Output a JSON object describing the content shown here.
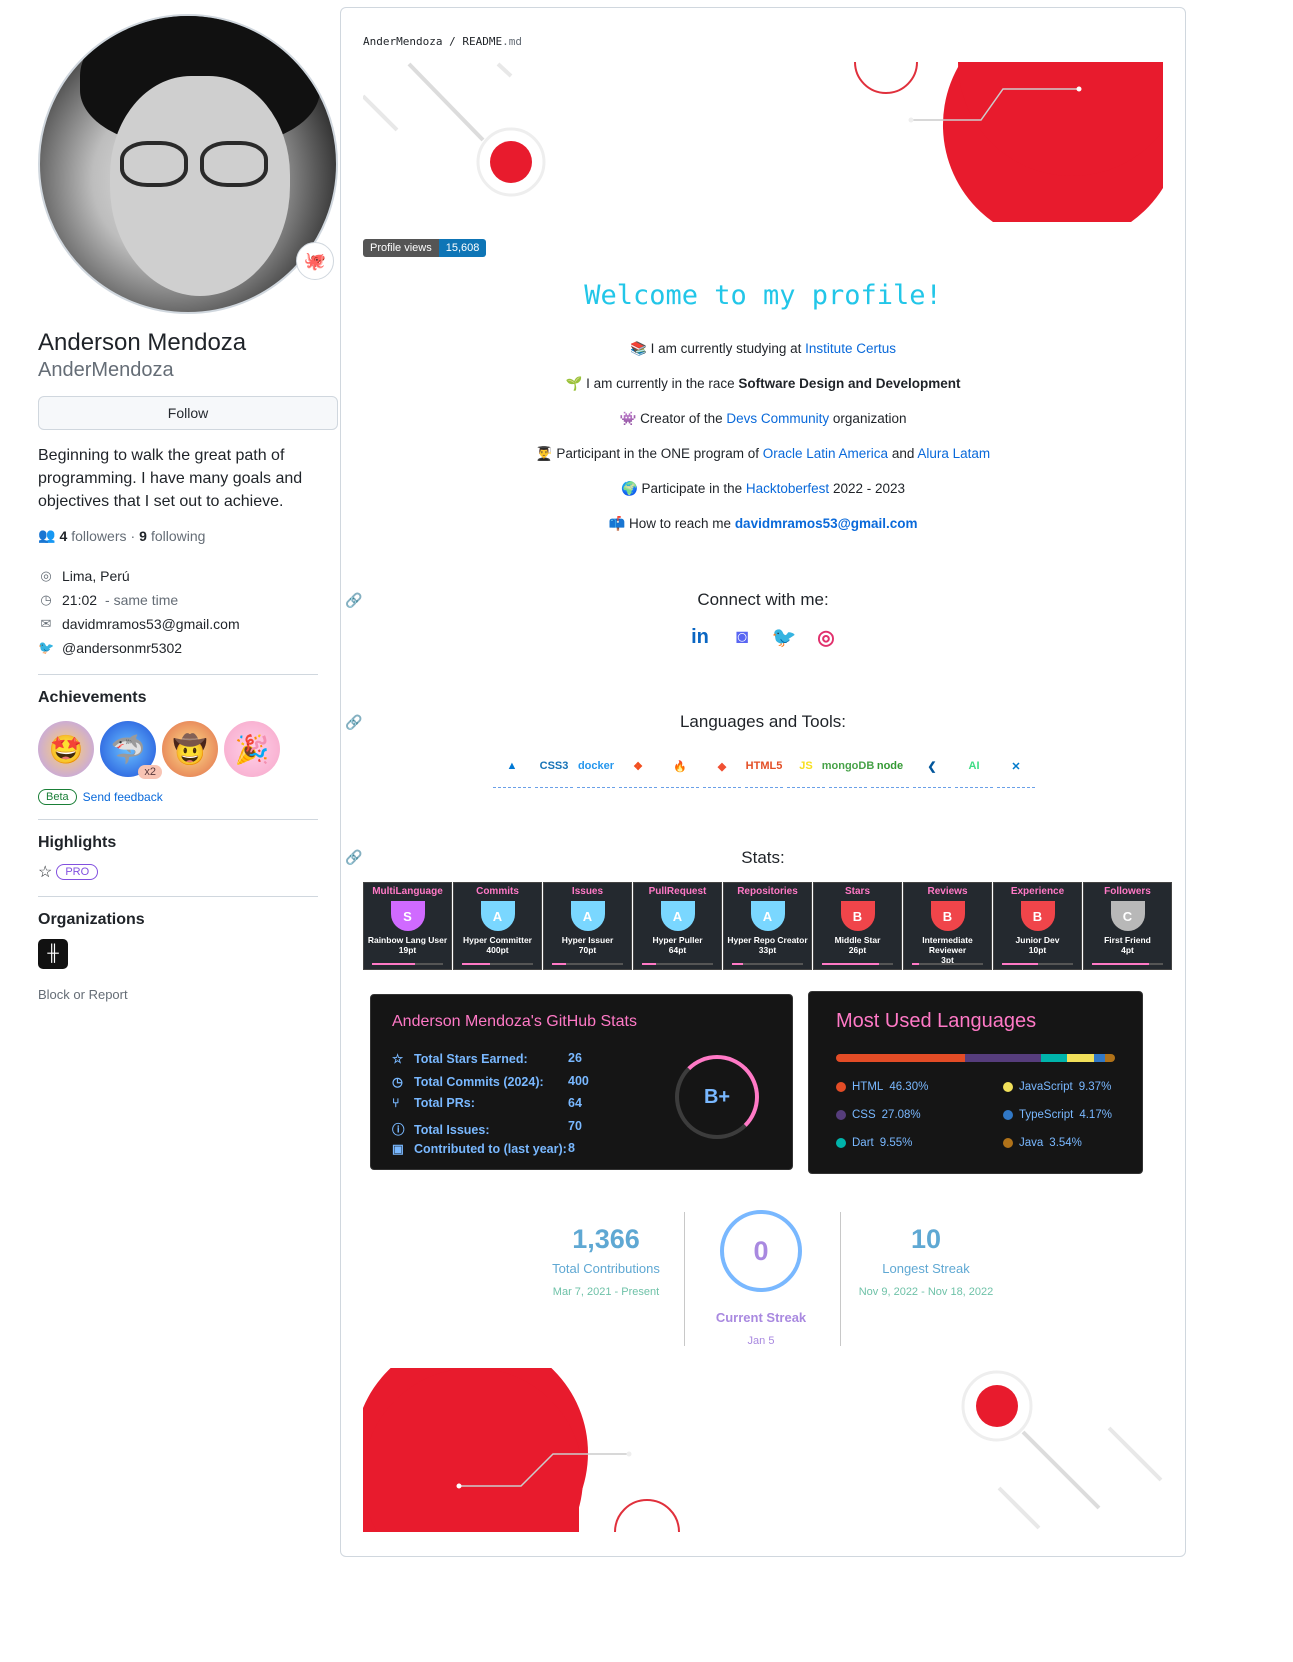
{
  "profile": {
    "name": "Anderson Mendoza",
    "login": "AnderMendoza",
    "follow_label": "Follow",
    "bio": "Beginning to walk the great path of programming. I have many goals and objectives that I set out to achieve.",
    "followers_count": "4",
    "followers_label": "followers",
    "following_count": "9",
    "following_label": "following",
    "location": "Lima, Perú",
    "time": "21:02",
    "time_note": "- same time",
    "email": "davidmramos53@gmail.com",
    "twitter": "@andersonmr5302",
    "achievements_title": "Achievements",
    "achievement_multiplier": "x2",
    "beta_label": "Beta",
    "feedback_label": "Send feedback",
    "highlights_title": "Highlights",
    "pro_label": "PRO",
    "organizations_title": "Organizations",
    "block_label": "Block or Report"
  },
  "readme": {
    "crumb_user": "AnderMendoza",
    "crumb_sep": "/",
    "crumb_file": "README",
    "crumb_ext": ".md",
    "views_label": "Profile views",
    "views_count": "15,608",
    "welcome": "Welcome to my profile!",
    "lines": {
      "l1_prefix": "I am currently studying at",
      "l1_link": "Institute Certus",
      "l2_prefix": "I am currently in the race",
      "l2_bold": "Software Design and Development",
      "l3_prefix": "Creator of the",
      "l3_link": "Devs Community",
      "l3_suffix": "organization",
      "l4_prefix": "Participant in the ONE program of",
      "l4_link1": "Oracle Latin America",
      "l4_and": "and",
      "l4_link2": "Alura Latam",
      "l5_prefix": "Participate in the",
      "l5_link": "Hacktoberfest",
      "l5_suffix": "2022 - 2023",
      "l6_prefix": "How to reach me",
      "l6_link": "davidmramos53@gmail.com"
    },
    "connect_title": "Connect with me:",
    "languages_title": "Languages and Tools:",
    "stats_title": "Stats:",
    "tools": [
      {
        "label": "▲",
        "color": "#0078d4"
      },
      {
        "label": "CSS3",
        "color": "#1572b6"
      },
      {
        "label": "docker",
        "color": "#2496ed"
      },
      {
        "label": "❖",
        "color": "#f24e1e"
      },
      {
        "label": "🔥",
        "color": "#ffca28"
      },
      {
        "label": "◆",
        "color": "#f05032"
      },
      {
        "label": "HTML5",
        "color": "#e34f26"
      },
      {
        "label": "JS",
        "color": "#f7df1e"
      },
      {
        "label": "mongoDB",
        "color": "#47a248"
      },
      {
        "label": "node",
        "color": "#339933"
      },
      {
        "label": "❮",
        "color": "#02569b"
      },
      {
        "label": "AI",
        "color": "#3ddc84"
      },
      {
        "label": "✕",
        "color": "#007acc"
      }
    ],
    "trophies": [
      {
        "title": "MultiLanguage",
        "grade": "S",
        "name": "Rainbow Lang User",
        "pt": "19pt",
        "progress": 0.6,
        "color": "#d06aff"
      },
      {
        "title": "Commits",
        "grade": "A",
        "name": "Hyper Committer",
        "pt": "400pt",
        "progress": 0.4,
        "color": "#7ad7ff"
      },
      {
        "title": "Issues",
        "grade": "A",
        "name": "Hyper Issuer",
        "pt": "70pt",
        "progress": 0.2,
        "color": "#7ad7ff"
      },
      {
        "title": "PullRequest",
        "grade": "A",
        "name": "Hyper Puller",
        "pt": "64pt",
        "progress": 0.2,
        "color": "#7ad7ff"
      },
      {
        "title": "Repositories",
        "grade": "A",
        "name": "Hyper Repo Creator",
        "pt": "33pt",
        "progress": 0.15,
        "color": "#7ad7ff"
      },
      {
        "title": "Stars",
        "grade": "B",
        "name": "Middle Star",
        "pt": "26pt",
        "progress": 0.8,
        "color": "#f0454a"
      },
      {
        "title": "Reviews",
        "grade": "B",
        "name": "Intermediate Reviewer",
        "pt": "3pt",
        "progress": 0.1,
        "color": "#f0454a"
      },
      {
        "title": "Experience",
        "grade": "B",
        "name": "Junior Dev",
        "pt": "10pt",
        "progress": 0.5,
        "color": "#f0454a"
      },
      {
        "title": "Followers",
        "grade": "C",
        "name": "First Friend",
        "pt": "4pt",
        "progress": 0.8,
        "color": "#b8b8b8"
      }
    ],
    "github_stats": {
      "title": "Anderson Mendoza's GitHub Stats",
      "rows": [
        {
          "label": "Total Stars Earned:",
          "value": "26"
        },
        {
          "label": "Total Commits (2024):",
          "value": "400"
        },
        {
          "label": "Total PRs:",
          "value": "64"
        },
        {
          "label": "Total Issues:",
          "value": "70"
        },
        {
          "label": "Contributed to (last year):",
          "value": "8"
        }
      ],
      "grade": "B+"
    },
    "top_langs": {
      "title": "Most Used Languages",
      "langs": [
        {
          "name": "HTML",
          "pct": "46.30%",
          "value": 46.3,
          "color": "#e34c26"
        },
        {
          "name": "CSS",
          "pct": "27.08%",
          "value": 27.08,
          "color": "#563d7c"
        },
        {
          "name": "Dart",
          "pct": "9.55%",
          "value": 9.55,
          "color": "#00b4ab"
        },
        {
          "name": "JavaScript",
          "pct": "9.37%",
          "value": 9.37,
          "color": "#f1e05a"
        },
        {
          "name": "TypeScript",
          "pct": "4.17%",
          "value": 4.17,
          "color": "#3178c6"
        },
        {
          "name": "Java",
          "pct": "3.54%",
          "value": 3.54,
          "color": "#b07219"
        }
      ]
    },
    "streak": {
      "total": "1,366",
      "total_label": "Total Contributions",
      "total_range": "Mar 7, 2021 - Present",
      "current": "0",
      "current_label": "Current Streak",
      "current_date": "Jan 5",
      "longest": "10",
      "longest_label": "Longest Streak",
      "longest_range": "Nov 9, 2022 - Nov 18, 2022"
    }
  }
}
